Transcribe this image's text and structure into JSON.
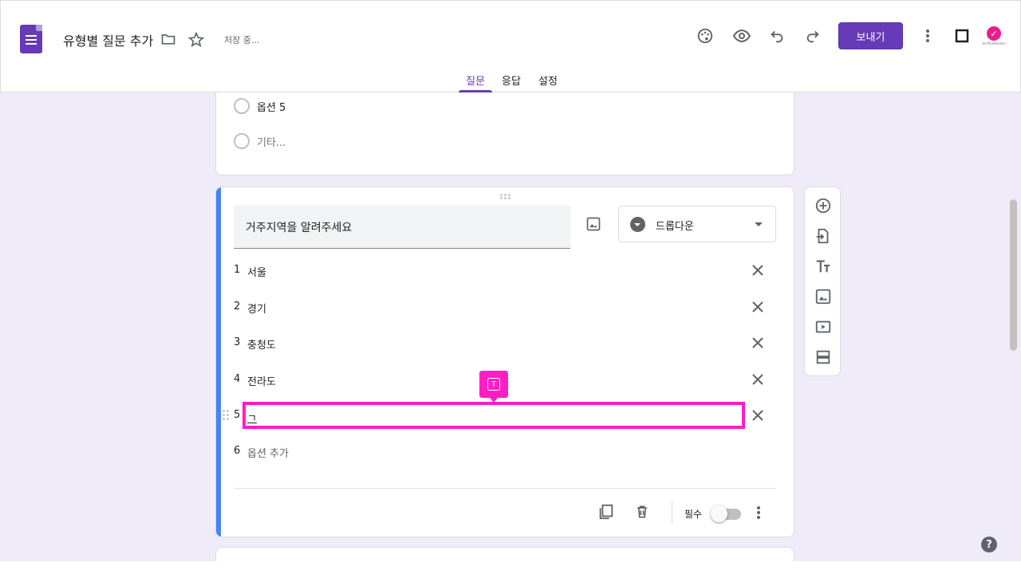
{
  "header": {
    "title": "유형별 질문 추가",
    "saving_status": "저장 중...",
    "send_label": "보내기",
    "accent": "#673ab7",
    "avatar_text": "VerifiedReader"
  },
  "tabs": [
    {
      "label": "질문",
      "active": true
    },
    {
      "label": "응답",
      "active": false
    },
    {
      "label": "설정",
      "active": false
    }
  ],
  "prev_card": {
    "options": [
      {
        "label": "옵션 5"
      },
      {
        "label": "기타..."
      }
    ]
  },
  "question": {
    "title": "거주지역을 알려주세요",
    "type_label": "드롭다운",
    "options": [
      {
        "num": "1",
        "label": "서울"
      },
      {
        "num": "2",
        "label": "경기"
      },
      {
        "num": "3",
        "label": "충청도"
      },
      {
        "num": "4",
        "label": "전라도"
      },
      {
        "num": "5",
        "label": "ㄱ"
      }
    ],
    "add_option": {
      "num": "6",
      "label": "옵션 추가"
    },
    "required_label": "필수",
    "required": false
  },
  "tooltip": {
    "glyph": "T"
  },
  "help": "?"
}
